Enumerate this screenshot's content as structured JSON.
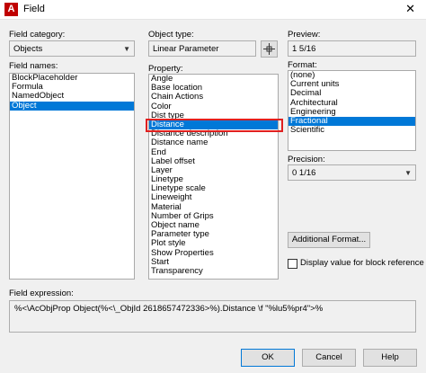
{
  "window": {
    "title": "Field",
    "close_glyph": "✕",
    "app_icon_letter": "A"
  },
  "field_category": {
    "label": "Field category:",
    "value": "Objects"
  },
  "field_names": {
    "label": "Field names:",
    "items": [
      "BlockPlaceholder",
      "Formula",
      "NamedObject",
      "Object"
    ],
    "selected": "Object"
  },
  "object_type": {
    "label": "Object type:",
    "value": "Linear Parameter"
  },
  "property": {
    "label": "Property:",
    "items": [
      "Angle",
      "Base location",
      "Chain Actions",
      "Color",
      "Dist type",
      "Distance",
      "Distance description",
      "Distance name",
      "End",
      "Label offset",
      "Layer",
      "Linetype",
      "Linetype scale",
      "Lineweight",
      "Material",
      "Number of Grips",
      "Object name",
      "Parameter type",
      "Plot style",
      "Show Properties",
      "Start",
      "Transparency"
    ],
    "selected": "Distance"
  },
  "preview": {
    "label": "Preview:",
    "value": "1 5/16"
  },
  "format": {
    "label": "Format:",
    "items": [
      "(none)",
      "Current units",
      "Decimal",
      "Architectural",
      "Engineering",
      "Fractional",
      "Scientific"
    ],
    "selected": "Fractional"
  },
  "precision": {
    "label": "Precision:",
    "value": "0 1/16"
  },
  "buttons": {
    "additional_format": "Additional Format...",
    "ok": "OK",
    "cancel": "Cancel",
    "help": "Help"
  },
  "block_reference": {
    "label": "Display value for block reference",
    "checked": false
  },
  "expression": {
    "label": "Field expression:",
    "value": "%<\\AcObjProp Object(%<\\_ObjId 2618657472336>%).Distance \\f \"%lu5%pr4\">%"
  },
  "colors": {
    "selection": "#0078d7",
    "highlight": "#e02020"
  }
}
